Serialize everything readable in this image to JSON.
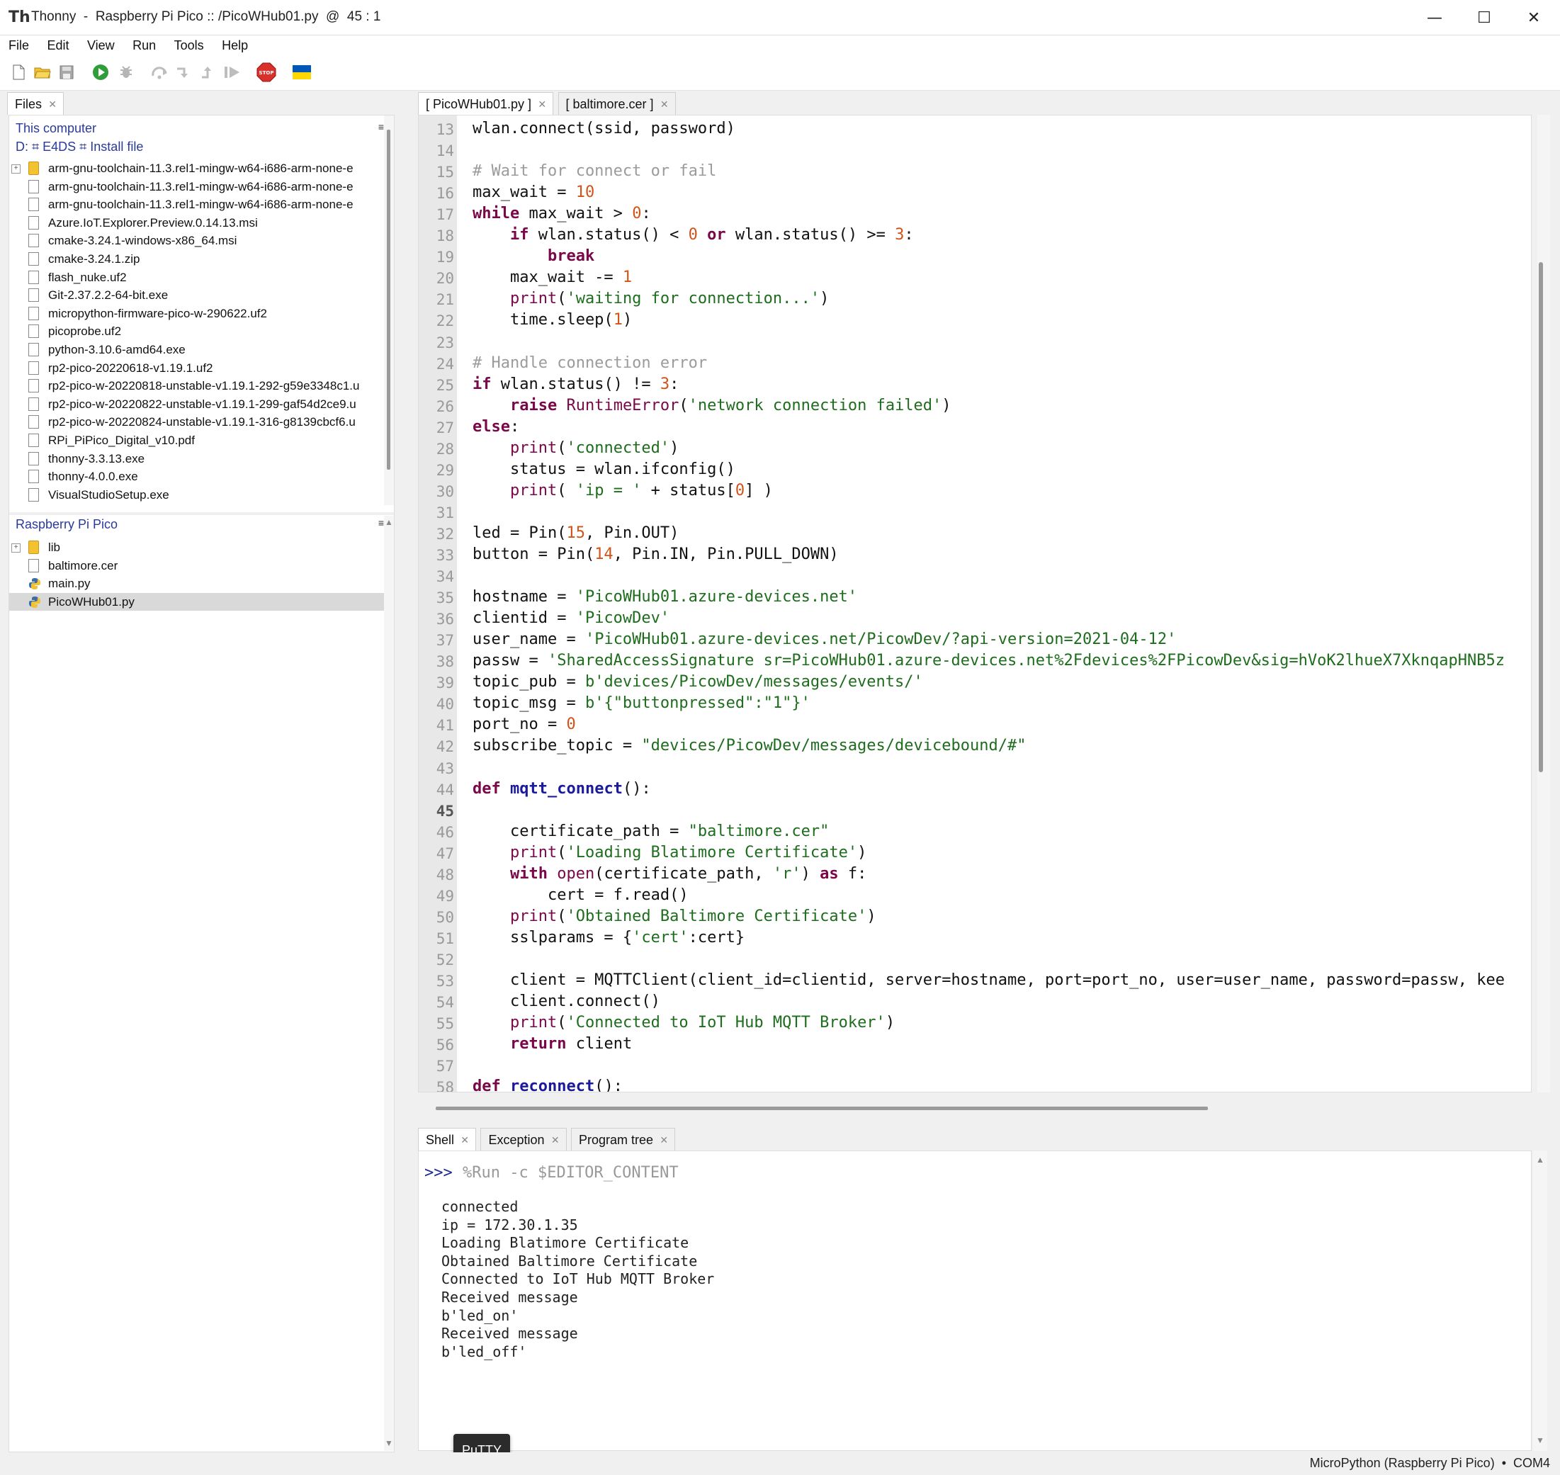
{
  "window": {
    "title": "Thonny  -  Raspberry Pi Pico :: /PicoWHub01.py  @  45 : 1",
    "minimize": "—",
    "maximize": "☐",
    "close": "✕"
  },
  "menu": [
    "File",
    "Edit",
    "View",
    "Run",
    "Tools",
    "Help"
  ],
  "toolbar_icons": [
    "new-file-icon",
    "open-file-icon",
    "save-icon",
    "run-icon",
    "debug-icon",
    "step-over-icon",
    "step-into-icon",
    "step-out-icon",
    "resume-icon",
    "stop-icon",
    "ukraine-flag-icon"
  ],
  "colors": {
    "stop": "#d9302c",
    "run": "#2e9d3a",
    "flag_blue": "#0057b7",
    "flag_yellow": "#ffd700"
  },
  "files_pane": {
    "tab_label": "Files",
    "this_computer": {
      "title": "This computer",
      "path": "D: ⌗ E4DS ⌗ Install file",
      "items": [
        {
          "name": "arm-gnu-toolchain-11.3.rel1-mingw-w64-i686-arm-none-e",
          "type": "folder"
        },
        {
          "name": "arm-gnu-toolchain-11.3.rel1-mingw-w64-i686-arm-none-e",
          "type": "file"
        },
        {
          "name": "arm-gnu-toolchain-11.3.rel1-mingw-w64-i686-arm-none-e",
          "type": "file"
        },
        {
          "name": "Azure.IoT.Explorer.Preview.0.14.13.msi",
          "type": "file"
        },
        {
          "name": "cmake-3.24.1-windows-x86_64.msi",
          "type": "file"
        },
        {
          "name": "cmake-3.24.1.zip",
          "type": "file"
        },
        {
          "name": "flash_nuke.uf2",
          "type": "file"
        },
        {
          "name": "Git-2.37.2.2-64-bit.exe",
          "type": "file"
        },
        {
          "name": "micropython-firmware-pico-w-290622.uf2",
          "type": "file"
        },
        {
          "name": "picoprobe.uf2",
          "type": "file"
        },
        {
          "name": "python-3.10.6-amd64.exe",
          "type": "file"
        },
        {
          "name": "rp2-pico-20220618-v1.19.1.uf2",
          "type": "file"
        },
        {
          "name": "rp2-pico-w-20220818-unstable-v1.19.1-292-g59e3348c1.u",
          "type": "file"
        },
        {
          "name": "rp2-pico-w-20220822-unstable-v1.19.1-299-gaf54d2ce9.u",
          "type": "file"
        },
        {
          "name": "rp2-pico-w-20220824-unstable-v1.19.1-316-g8139cbcf6.u",
          "type": "file"
        },
        {
          "name": "RPi_PiPico_Digital_v10.pdf",
          "type": "file"
        },
        {
          "name": "thonny-3.3.13.exe",
          "type": "file"
        },
        {
          "name": "thonny-4.0.0.exe",
          "type": "file"
        },
        {
          "name": "VisualStudioSetup.exe",
          "type": "file"
        }
      ]
    },
    "pico": {
      "title": "Raspberry Pi Pico",
      "items": [
        {
          "name": "lib",
          "type": "folder"
        },
        {
          "name": "baltimore.cer",
          "type": "file"
        },
        {
          "name": "main.py",
          "type": "py"
        },
        {
          "name": "PicoWHub01.py",
          "type": "py",
          "selected": true
        }
      ]
    }
  },
  "editor": {
    "tabs": [
      {
        "label": "[ PicoWHub01.py ]",
        "active": true
      },
      {
        "label": "[ baltimore.cer ]",
        "active": false
      }
    ],
    "lines": [
      {
        "n": "13",
        "html": "wlan.connect(ssid, password)"
      },
      {
        "n": "14",
        "html": ""
      },
      {
        "n": "15",
        "html": "<span class='com'># Wait for connect or fail</span>"
      },
      {
        "n": "16",
        "html": "max_wait = <span class='num'>10</span>"
      },
      {
        "n": "17",
        "html": "<span class='kw'>while</span> max_wait &gt; <span class='num'>0</span>:"
      },
      {
        "n": "18",
        "html": "    <span class='kw'>if</span> wlan.status() &lt; <span class='num'>0</span> <span class='kw'>or</span> wlan.status() &gt;= <span class='num'>3</span>:"
      },
      {
        "n": "19",
        "html": "        <span class='kw'>break</span>"
      },
      {
        "n": "20",
        "html": "    max_wait -= <span class='num'>1</span>"
      },
      {
        "n": "21",
        "html": "    <span class='bi'>print</span>(<span class='str'>'waiting for connection...'</span>)"
      },
      {
        "n": "22",
        "html": "    time.sleep(<span class='num'>1</span>)"
      },
      {
        "n": "23",
        "html": ""
      },
      {
        "n": "24",
        "html": "<span class='com'># Handle connection error</span>"
      },
      {
        "n": "25",
        "html": "<span class='kw'>if</span> wlan.status() != <span class='num'>3</span>:"
      },
      {
        "n": "26",
        "html": "    <span class='kw'>raise</span> <span class='cls'>RuntimeError</span>(<span class='str'>'network connection failed'</span>)"
      },
      {
        "n": "27",
        "html": "<span class='kw'>else</span>:"
      },
      {
        "n": "28",
        "html": "    <span class='bi'>print</span>(<span class='str'>'connected'</span>)"
      },
      {
        "n": "29",
        "html": "    status = wlan.ifconfig()"
      },
      {
        "n": "30",
        "html": "    <span class='bi'>print</span>( <span class='str'>'ip = '</span> + status[<span class='num'>0</span>] )"
      },
      {
        "n": "31",
        "html": ""
      },
      {
        "n": "32",
        "html": "led = Pin(<span class='num'>15</span>, Pin.OUT)"
      },
      {
        "n": "33",
        "html": "button = Pin(<span class='num'>14</span>, Pin.IN, Pin.PULL_DOWN)"
      },
      {
        "n": "34",
        "html": ""
      },
      {
        "n": "35",
        "html": "hostname = <span class='str'>'PicoWHub01.azure-devices.net'</span>"
      },
      {
        "n": "36",
        "html": "clientid = <span class='str'>'PicowDev'</span>"
      },
      {
        "n": "37",
        "html": "user_name = <span class='str'>'PicoWHub01.azure-devices.net/PicowDev/?api-version=2021-04-12'</span>"
      },
      {
        "n": "38",
        "html": "passw = <span class='str'>'SharedAccessSignature sr=PicoWHub01.azure-devices.net%2Fdevices%2FPicowDev&amp;sig=hVoK2lhueX7XknqapHNB5z</span>"
      },
      {
        "n": "39",
        "html": "topic_pub = <span class='str'>b'devices/PicowDev/messages/events/'</span>"
      },
      {
        "n": "40",
        "html": "topic_msg = <span class='str'>b'{\"buttonpressed\":\"1\"}'</span>"
      },
      {
        "n": "41",
        "html": "port_no = <span class='num'>0</span>"
      },
      {
        "n": "42",
        "html": "subscribe_topic = <span class='str'>\"devices/PicowDev/messages/devicebound/#\"</span>"
      },
      {
        "n": "43",
        "html": ""
      },
      {
        "n": "44",
        "html": "<span class='kw'>def</span> <span class='fn'>mqtt_connect</span>():"
      },
      {
        "n": "45",
        "html": ""
      },
      {
        "n": "46",
        "html": "    certificate_path = <span class='str'>\"baltimore.cer\"</span>"
      },
      {
        "n": "47",
        "html": "    <span class='bi'>print</span>(<span class='str'>'Loading Blatimore Certificate'</span>)"
      },
      {
        "n": "48",
        "html": "    <span class='kw'>with</span> <span class='bi'>open</span>(certificate_path, <span class='str'>'r'</span>) <span class='kw'>as</span> f:"
      },
      {
        "n": "49",
        "html": "        cert = f.read()"
      },
      {
        "n": "50",
        "html": "    <span class='bi'>print</span>(<span class='str'>'Obtained Baltimore Certificate'</span>)"
      },
      {
        "n": "51",
        "html": "    sslparams = {<span class='str'>'cert'</span>:cert}"
      },
      {
        "n": "52",
        "html": ""
      },
      {
        "n": "53",
        "html": "    client = MQTTClient(client_id=clientid, server=hostname, port=port_no, user=user_name, password=passw, kee"
      },
      {
        "n": "54",
        "html": "    client.connect()"
      },
      {
        "n": "55",
        "html": "    <span class='bi'>print</span>(<span class='str'>'Connected to IoT Hub MQTT Broker'</span>)"
      },
      {
        "n": "56",
        "html": "    <span class='kw'>return</span> client"
      },
      {
        "n": "57",
        "html": ""
      },
      {
        "n": "58",
        "html": "<span class='kw'>def</span> <span class='fn'>reconnect</span>():"
      }
    ]
  },
  "shell": {
    "tabs": [
      {
        "label": "Shell",
        "active": true
      },
      {
        "label": "Exception",
        "active": false
      },
      {
        "label": "Program tree",
        "active": false
      }
    ],
    "prompt": ">>>",
    "command": "%Run -c $EDITOR_CONTENT",
    "output": [
      "connected",
      "ip = 172.30.1.35",
      "Loading Blatimore Certificate",
      "Obtained Baltimore Certificate",
      "Connected to IoT Hub MQTT Broker",
      "Received message",
      "b'led_on'",
      "Received message",
      "b'led_off'"
    ]
  },
  "tooltip": "PuTTY",
  "status": "MicroPython (Raspberry Pi Pico)  •  COM4"
}
